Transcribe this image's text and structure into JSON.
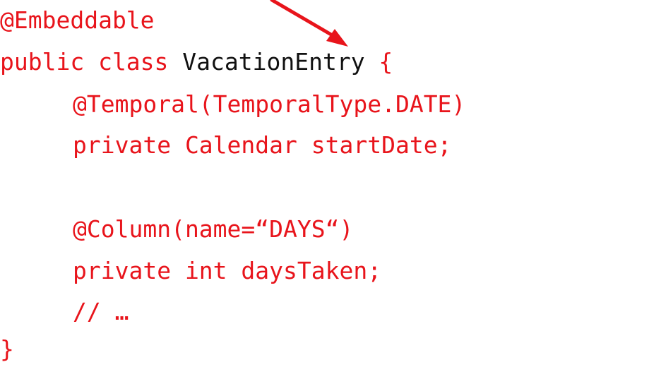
{
  "code_lines": {
    "line1": "@Embeddable",
    "line2_prefix": "public class ",
    "line2_class_name": "VacationEntry",
    "line2_suffix": " {",
    "line3": "@Temporal(TemporalType.DATE)",
    "line4": "private Calendar startDate;",
    "line5": "@Column(name=“DAYS“)",
    "line6": "private int daysTaken;",
    "line7": "// …",
    "line8": "}"
  },
  "colors": {
    "code_text": "#e8141b",
    "class_name_text": "#111111",
    "arrow": "#e8141b",
    "background": "#ffffff"
  }
}
